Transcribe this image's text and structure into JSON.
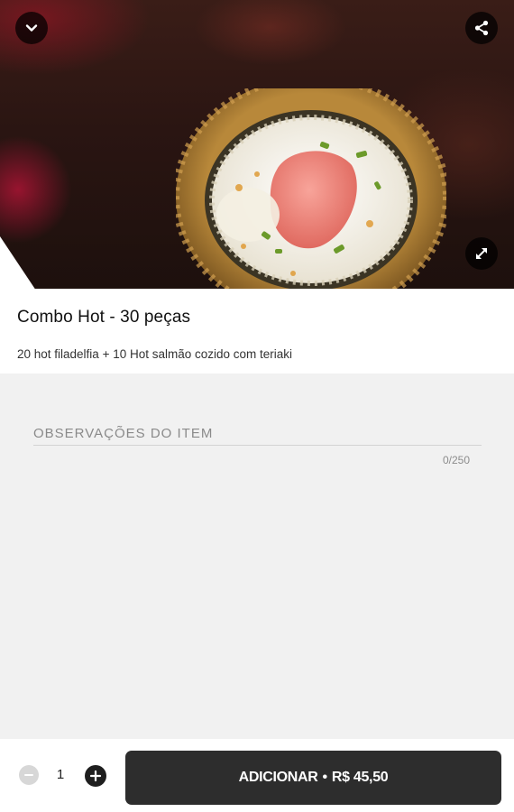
{
  "hero": {
    "image_alt": "",
    "icons": {
      "collapse": "chevron-down-icon",
      "share": "share-icon",
      "expand": "expand-icon"
    }
  },
  "item": {
    "title": "Combo Hot - 30 peças",
    "description": "20 hot filadelfia + 10 Hot salmão cozido com teriaki"
  },
  "notes": {
    "placeholder": "OBSERVAÇÕES DO ITEM",
    "value": "",
    "counter": "0/250"
  },
  "footer": {
    "quantity": "1",
    "add_label": "ADICIONAR",
    "separator": "•",
    "price": "R$ 45,50",
    "icons": {
      "decrement": "minus-circle-icon",
      "increment": "plus-circle-icon"
    }
  },
  "colors": {
    "button_bg": "#2d2d2d",
    "notes_bg": "#f1f1f1",
    "plus_bg": "#1e1e1e",
    "minus_bg": "#d7d7d7"
  }
}
